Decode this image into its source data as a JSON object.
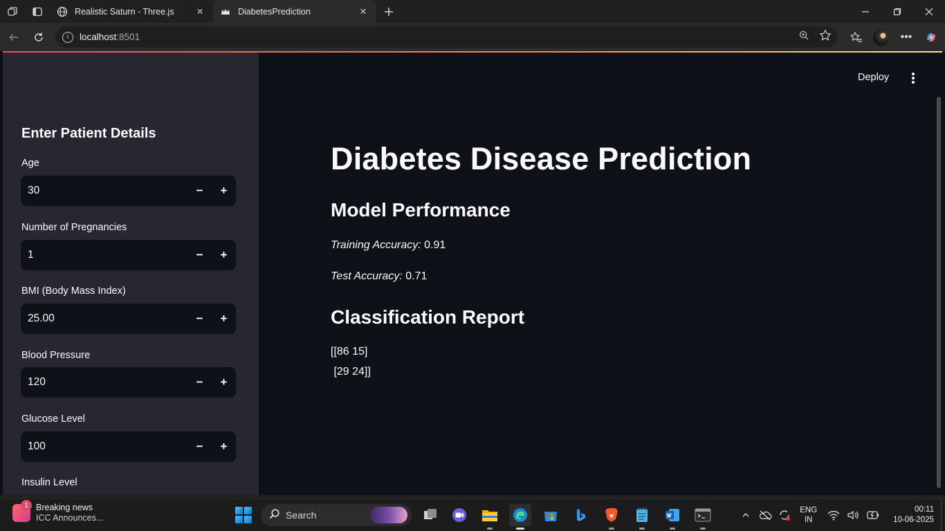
{
  "browser": {
    "tabs": [
      {
        "title": "Realistic Saturn - Three.js",
        "active": false
      },
      {
        "title": "DiabetesPrediction",
        "active": true
      }
    ],
    "url_host": "localhost",
    "url_port": ":8501"
  },
  "app": {
    "deploy_label": "Deploy",
    "sidebar": {
      "heading": "Enter Patient Details",
      "fields": [
        {
          "label": "Age",
          "value": "30"
        },
        {
          "label": "Number of Pregnancies",
          "value": "1"
        },
        {
          "label": "BMI (Body Mass Index)",
          "value": "25.00"
        },
        {
          "label": "Blood Pressure",
          "value": "120"
        },
        {
          "label": "Glucose Level",
          "value": "100"
        }
      ],
      "partial_label": "Insulin Level",
      "minus": "−",
      "plus": "+"
    },
    "main": {
      "title": "Diabetes Disease Prediction",
      "perf_heading": "Model Performance",
      "train_label": "Training Accuracy:",
      "train_value": " 0.91",
      "test_label": "Test Accuracy:",
      "test_value": " 0.71",
      "report_heading": "Classification Report",
      "matrix_line1": "[[86 15]",
      "matrix_line2": " [29 24]]"
    }
  },
  "taskbar": {
    "news_title": "Breaking news",
    "news_sub": "ICC Announces...",
    "news_badge": "1",
    "search_label": "Search",
    "lang_line1": "ENG",
    "lang_line2": "IN",
    "time": "00:11",
    "date": "10-06-2025"
  },
  "colors": {
    "sidebar_bg": "#262730",
    "main_bg": "#0e1117",
    "accent": "#ff4b4b"
  }
}
